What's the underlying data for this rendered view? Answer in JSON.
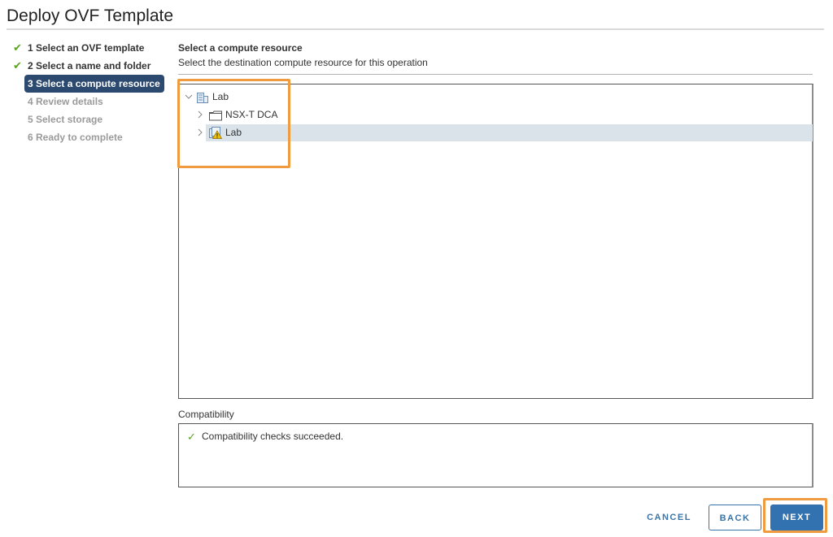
{
  "window": {
    "title": "Deploy OVF Template"
  },
  "wizard": {
    "steps": [
      {
        "label": "1 Select an OVF template",
        "status": "done"
      },
      {
        "label": "2 Select a name and folder",
        "status": "done"
      },
      {
        "label": "3 Select a compute resource",
        "status": "active"
      },
      {
        "label": "4 Review details",
        "status": "todo"
      },
      {
        "label": "5 Select storage",
        "status": "todo"
      },
      {
        "label": "6 Ready to complete",
        "status": "todo"
      }
    ]
  },
  "main": {
    "section_title": "Select a compute resource",
    "section_subtitle": "Select the destination compute resource for this operation",
    "tree": [
      {
        "label": "Lab",
        "type": "datacenter",
        "expanded": true,
        "level": 0,
        "selected": false
      },
      {
        "label": "NSX-T DCA",
        "type": "folder",
        "expanded": false,
        "level": 1,
        "selected": false
      },
      {
        "label": "Lab",
        "type": "cluster-warning",
        "expanded": false,
        "level": 1,
        "selected": true
      }
    ],
    "compatibility": {
      "label": "Compatibility",
      "message": "Compatibility checks succeeded.",
      "status_color": "#5aa220"
    }
  },
  "footer": {
    "cancel_label": "CANCEL",
    "back_label": "BACK",
    "next_label": "NEXT"
  },
  "colors": {
    "accent": "#3272b0",
    "active_step_bg": "#2c4a6f",
    "selection_bg": "#dae3ea",
    "highlight": "#ef9b3f"
  }
}
